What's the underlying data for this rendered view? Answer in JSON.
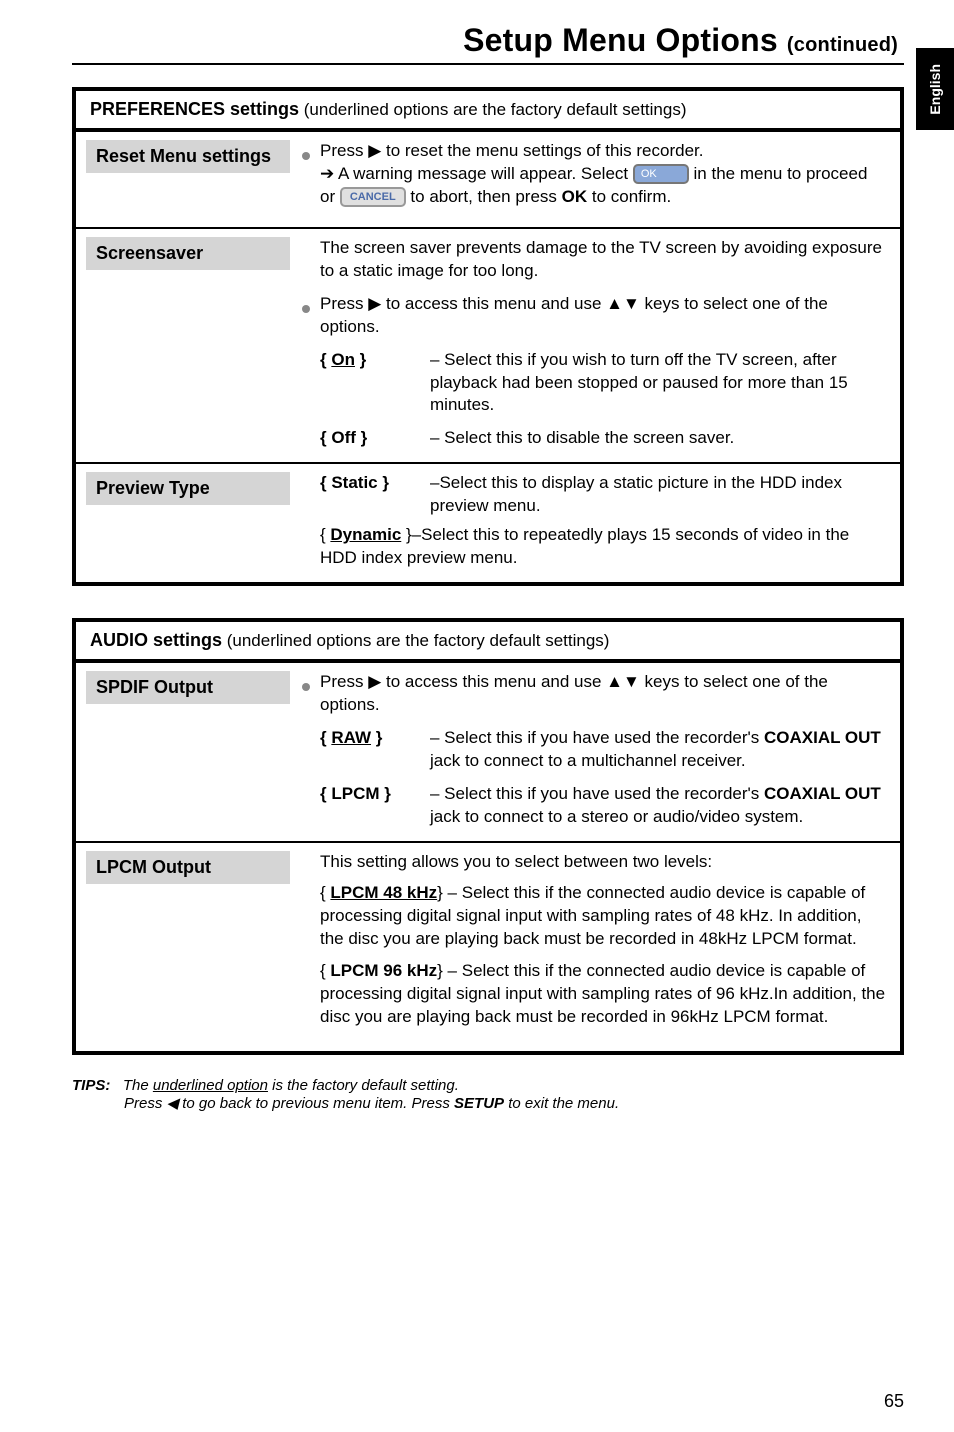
{
  "header": {
    "title": "Setup Menu Options",
    "suffix": "(continued)"
  },
  "sideTab": "English",
  "preferences": {
    "heading_bold": "PREFERENCES settings",
    "heading_rest": " (underlined options are the factory default settings)",
    "resetMenu": {
      "label": "Reset Menu settings",
      "line1a": "Press ",
      "line1b": " to reset the menu settings of this recorder.",
      "line2a": " A warning message will appear. Select ",
      "line2b": " in the menu to proceed or ",
      "line2c": " to abort, then press ",
      "line2ok": "OK",
      "line2d": " to confirm.",
      "pillOK": "OK",
      "pillCancel": "CANCEL"
    },
    "screensaver": {
      "label": "Screensaver",
      "para1": "The screen saver prevents damage to the TV screen by avoiding  exposure to a static image for too long.",
      "para2a": "Press ",
      "para2b": " to access this menu and use ",
      "para2c": " keys to select one of the options.",
      "on": {
        "label": "On",
        "desc": "– Select this if you wish to turn off the TV screen, after playback had been stopped or paused for more than 15 minutes."
      },
      "off": {
        "label": "Off",
        "desc": "– Select this to disable the screen saver."
      }
    },
    "preview": {
      "label": "Preview Type",
      "static": {
        "label": "Static",
        "desc": "–Select this to display a static picture in the HDD index preview menu."
      },
      "dynamic": {
        "label": "Dynamic",
        "desc": " }–Select this to repeatedly plays 15 seconds of video in the HDD index preview menu."
      }
    }
  },
  "audio": {
    "heading_bold": "AUDIO settings",
    "heading_rest": " (underlined options are the factory default settings)",
    "spdif": {
      "label": "SPDIF Output",
      "introA": "Press ",
      "introB": " to access this menu and use ",
      "introC": " keys to select one of the options.",
      "raw": {
        "label": "RAW",
        "desc1": "– Select this if you have used the recorder's ",
        "coax": "COAXIAL OUT",
        "desc2": " jack to connect to a multichannel receiver."
      },
      "lpcm": {
        "label": "LPCM",
        "desc1": "– Select this if you have used the recorder's ",
        "coax": "COAXIAL OUT",
        "desc2": " jack to connect to a stereo or audio/video system."
      }
    },
    "lpcmOut": {
      "label": "LPCM Output",
      "intro": "This setting allows you to select between two levels:",
      "opt48": {
        "label": "LPCM 48 kHz",
        "desc": "} – Select this if the connected audio device is capable of processing digital signal input with sampling rates of 48 kHz. In addition, the disc you are playing back must be recorded in 48kHz LPCM format."
      },
      "opt96": {
        "label": "LPCM 96 kHz",
        "desc": "} – Select this if the connected audio device is capable of processing digital signal input with sampling rates of 96 kHz.In addition, the disc you are playing back must be recorded in 96kHz LPCM format."
      }
    }
  },
  "tips": {
    "label": "TIPS:",
    "line1a": "The ",
    "line1u": "underlined option",
    "line1b": " is the factory default setting.",
    "line2a": "Press ",
    "line2b": " to go back to previous menu item. Press ",
    "line2setup": "SETUP",
    "line2c": " to exit the menu."
  },
  "pageNumber": "65"
}
